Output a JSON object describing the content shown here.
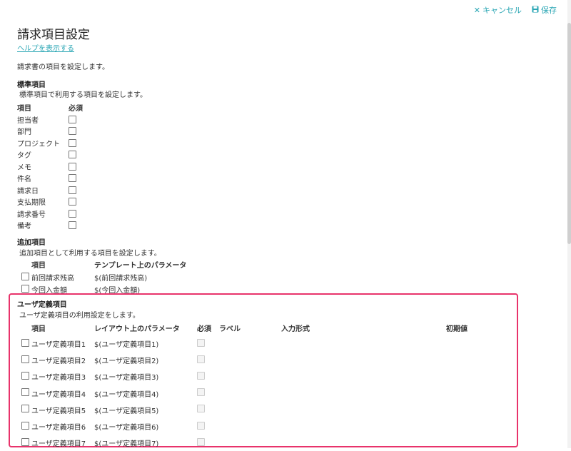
{
  "toolbar": {
    "cancel_label": "キャンセル",
    "save_label": "保存"
  },
  "page": {
    "title": "請求項目設定",
    "help_link": "ヘルプを表示する",
    "description": "請求書の項目を設定します。"
  },
  "standard": {
    "title": "標準項目",
    "description": "標準項目で利用する項目を設定します。",
    "col_item": "項目",
    "col_required": "必須",
    "items": [
      "担当者",
      "部門",
      "プロジェクト",
      "タグ",
      "メモ",
      "件名",
      "請求日",
      "支払期限",
      "請求番号",
      "備考"
    ]
  },
  "additional": {
    "title": "追加項目",
    "description": "追加項目として利用する項目を設定します。",
    "col_item": "項目",
    "col_param": "テンプレート上のパラメータ",
    "items": [
      {
        "label": "前回請求残高",
        "param": "$(前回請求残高)"
      },
      {
        "label": "今回入金額",
        "param": "$(今回入金額)"
      }
    ]
  },
  "user_defined": {
    "title": "ユーザ定義項目",
    "description": "ユーザ定義項目の利用設定をします。",
    "col_item": "項目",
    "col_param": "レイアウト上のパラメータ",
    "col_required": "必須",
    "col_label": "ラベル",
    "col_input_type": "入力形式",
    "col_default": "初期値",
    "items": [
      {
        "label": "ユーザ定義項目1",
        "param": "$(ユーザ定義項目1)"
      },
      {
        "label": "ユーザ定義項目2",
        "param": "$(ユーザ定義項目2)"
      },
      {
        "label": "ユーザ定義項目3",
        "param": "$(ユーザ定義項目3)"
      },
      {
        "label": "ユーザ定義項目4",
        "param": "$(ユーザ定義項目4)"
      },
      {
        "label": "ユーザ定義項目5",
        "param": "$(ユーザ定義項目5)"
      },
      {
        "label": "ユーザ定義項目6",
        "param": "$(ユーザ定義項目6)"
      },
      {
        "label": "ユーザ定義項目7",
        "param": "$(ユーザ定義項目7)"
      }
    ]
  },
  "colors": {
    "accent": "#2aa6b4",
    "highlight": "#e8336b"
  }
}
